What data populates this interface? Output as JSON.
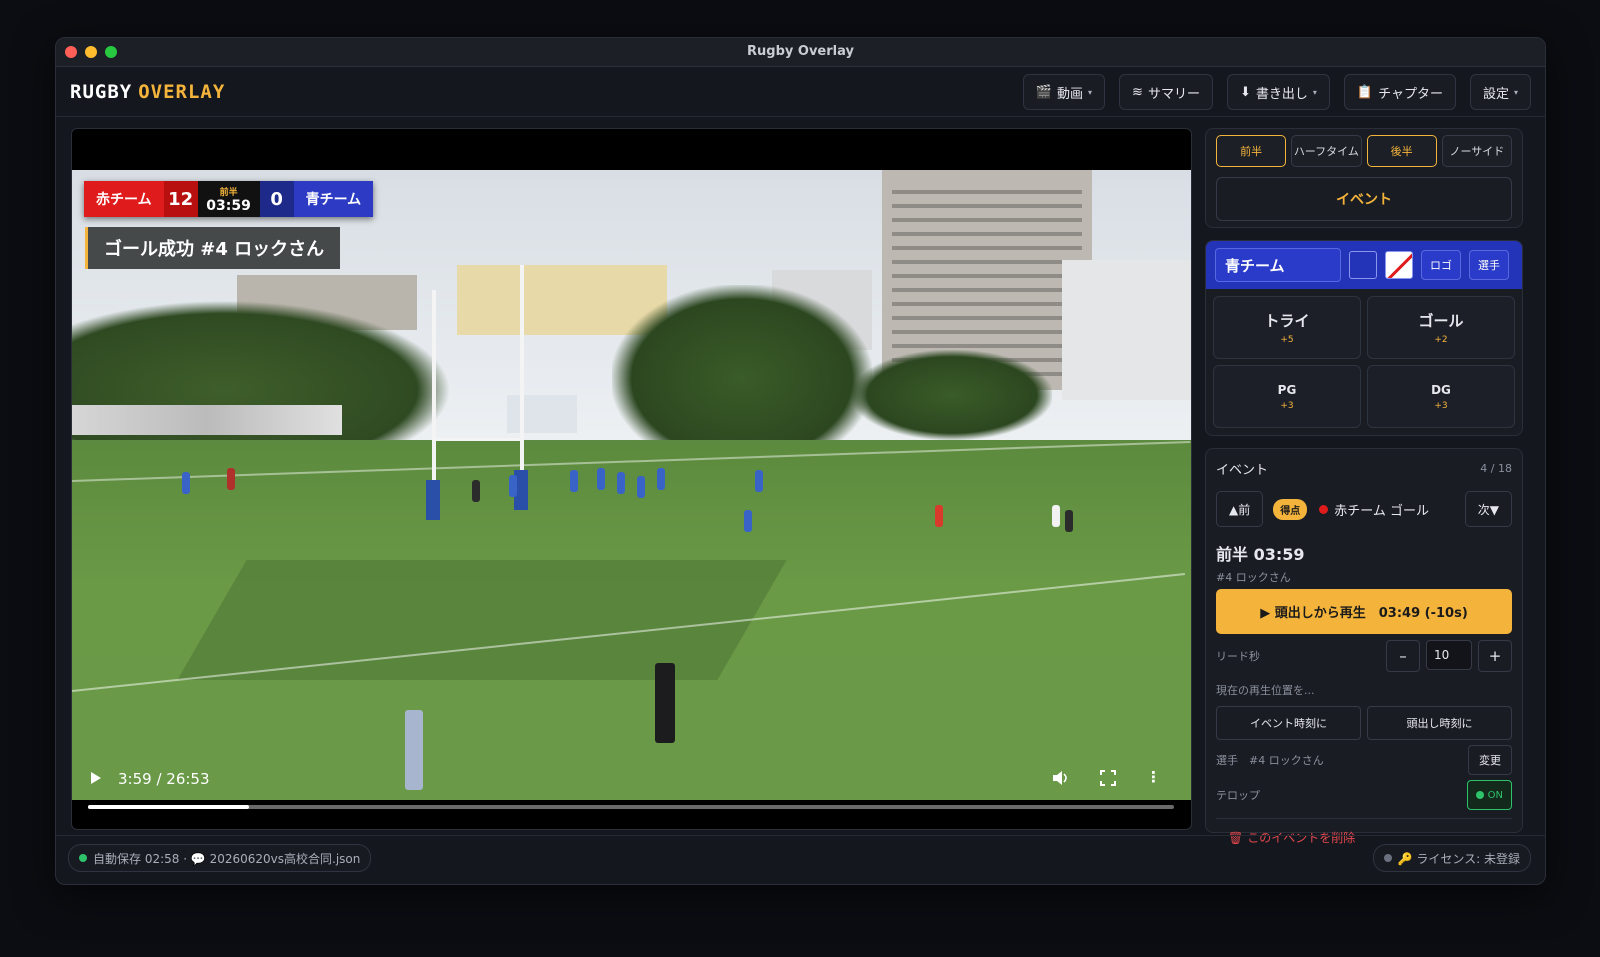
{
  "window": {
    "title": "Rugby Overlay"
  },
  "logo": {
    "part1": "RUGBY",
    "part2": "OVERLAY"
  },
  "menu": [
    {
      "icon": "🎬",
      "label": "動画",
      "caret": "▾"
    },
    {
      "icon": "≋",
      "label": "サマリー",
      "caret": ""
    },
    {
      "icon": "⬇",
      "label": "書き出し",
      "caret": "▾"
    },
    {
      "icon": "📋",
      "label": "チャプター",
      "caret": ""
    },
    {
      "icon": "",
      "label": "設定",
      "caret": "▾"
    }
  ],
  "scorebug": {
    "home_name": "赤チーム",
    "home_score": "12",
    "half": "前半",
    "clock": "03:59",
    "away_score": "0",
    "away_name": "青チーム"
  },
  "telop": "ゴール成功 #4 ロックさん",
  "player_controls": {
    "time": "3:59 / 26:53",
    "progress": 0.148
  },
  "phases": [
    {
      "label": "前半",
      "active": true
    },
    {
      "label": "ハーフタイム",
      "active": false
    },
    {
      "label": "後半",
      "active": true
    },
    {
      "label": "ノーサイド",
      "active": false
    }
  ],
  "event_button": "イベント",
  "team": {
    "name": "青チーム",
    "logo_btn": "ロゴ",
    "players_btn": "選手",
    "color": "#2434b9",
    "scoring": [
      {
        "name": "トライ",
        "pts": "+5"
      },
      {
        "name": "ゴール",
        "pts": "+2"
      },
      {
        "name": "PG",
        "pts": "+3"
      },
      {
        "name": "DG",
        "pts": "+3"
      }
    ]
  },
  "events": {
    "title": "イベント",
    "count": "4 / 18",
    "prev": "▲前",
    "next": "次▼",
    "badge": "得点",
    "desc": "赤チーム ゴール",
    "time": "前半 03:59",
    "player": "#4 ロックさん",
    "play_label": "▶ 頭出しから再生　03:49 (-10s)",
    "lead_label": "リード秒",
    "lead_minus": "–",
    "lead_value": "10",
    "lead_plus": "+",
    "current_pos_label": "現在の再生位置を...",
    "to_event_time": "イベント時刻に",
    "to_cue_time": "頭出し時刻に",
    "player_label": "選手　#4 ロックさん",
    "change": "変更",
    "telop_label": "テロップ",
    "telop_state": "ON",
    "delete": "このイベントを削除"
  },
  "status": {
    "autosave": "自動保存 02:58 · 💬 20260620vs高校合同.json",
    "license": "🔑 ライセンス: 未登録"
  }
}
